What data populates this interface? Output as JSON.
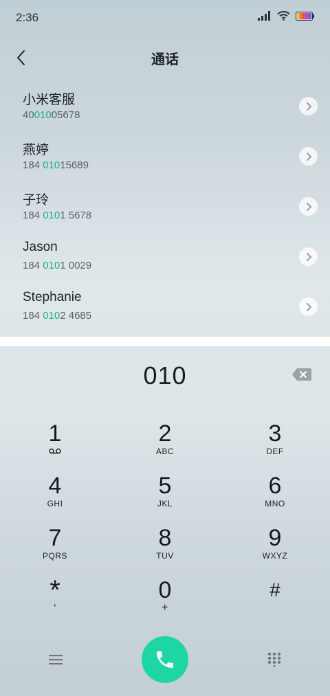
{
  "status": {
    "time": "2:36"
  },
  "header": {
    "title": "通话"
  },
  "contacts": [
    {
      "name": "小米客服",
      "pre": "40",
      "hl": "010",
      "post": "05678"
    },
    {
      "name": "燕婷",
      "pre": "184 ",
      "hl": "010",
      "post": "15689"
    },
    {
      "name": "子玲",
      "pre": "184 ",
      "hl": "010",
      "post": "1 5678"
    },
    {
      "name": "Jason",
      "pre": "184 ",
      "hl": "010",
      "post": "1 0029"
    },
    {
      "name": "Stephanie",
      "pre": "184 ",
      "hl": "010",
      "post": "2 4685"
    }
  ],
  "dialer": {
    "input": "010"
  },
  "keys": [
    {
      "num": "1",
      "sub": ""
    },
    {
      "num": "2",
      "sub": "ABC"
    },
    {
      "num": "3",
      "sub": "DEF"
    },
    {
      "num": "4",
      "sub": "GHI"
    },
    {
      "num": "5",
      "sub": "JKL"
    },
    {
      "num": "6",
      "sub": "MNO"
    },
    {
      "num": "7",
      "sub": "PQRS"
    },
    {
      "num": "8",
      "sub": "TUV"
    },
    {
      "num": "9",
      "sub": "WXYZ"
    },
    {
      "num": "*",
      "sub": ","
    },
    {
      "num": "0",
      "sub": "+"
    },
    {
      "num": "#",
      "sub": ""
    }
  ],
  "colors": {
    "accent": "#1ed6a4",
    "highlight": "#1fae7e"
  },
  "icons": {
    "back": "chevron-left-icon",
    "arrow": "chevron-right-icon",
    "backspace": "backspace-icon",
    "voicemail": "voicemail-icon",
    "menu": "menu-icon",
    "call": "phone-icon",
    "keypad": "dialpad-icon"
  }
}
